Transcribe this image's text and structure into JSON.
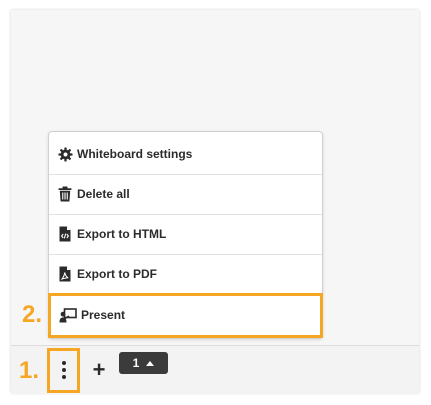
{
  "menu": {
    "items": [
      {
        "label": "Whiteboard settings",
        "icon": "gear-icon"
      },
      {
        "label": "Delete all",
        "icon": "trash-icon"
      },
      {
        "label": "Export to HTML",
        "icon": "file-code-icon"
      },
      {
        "label": "Export to PDF",
        "icon": "file-pdf-icon"
      },
      {
        "label": "Present",
        "icon": "present-icon"
      }
    ]
  },
  "annotations": {
    "step1": "1.",
    "step2": "2.",
    "color": "#f5a623"
  },
  "toolbar": {
    "add_label": "+",
    "page_number": "1"
  }
}
